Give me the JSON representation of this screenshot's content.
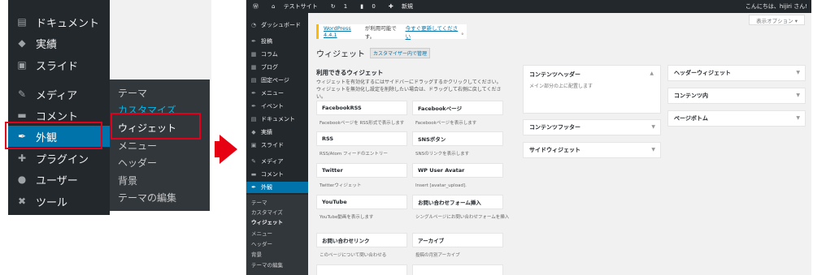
{
  "zoom_menu": {
    "items": [
      {
        "icon": "document-icon",
        "glyph": "▤",
        "label": "ドキュメント"
      },
      {
        "icon": "tag-icon",
        "glyph": "◆",
        "label": "実績"
      },
      {
        "icon": "slide-icon",
        "glyph": "▣",
        "label": "スライド"
      },
      {
        "icon": "media-icon",
        "glyph": "✎",
        "label": "メディア"
      },
      {
        "icon": "comment-icon",
        "glyph": "▬",
        "label": "コメント"
      },
      {
        "icon": "appearance-icon",
        "glyph": "✒",
        "label": "外観"
      },
      {
        "icon": "plugin-icon",
        "glyph": "✚",
        "label": "プラグイン"
      },
      {
        "icon": "user-icon",
        "glyph": "●",
        "label": "ユーザー"
      },
      {
        "icon": "tool-icon",
        "glyph": "✖",
        "label": "ツール"
      }
    ],
    "submenu": [
      "テーマ",
      "カスタマイズ",
      "ウィジェット",
      "メニュー",
      "ヘッダー",
      "背景",
      "テーマの編集"
    ]
  },
  "admin_bar": {
    "site": "テストサイト",
    "updates": "1",
    "comments": "0",
    "new": "新規",
    "greeting": "こんにちは、hijiri さん!"
  },
  "sidebar": {
    "items": [
      "ダッシュボード",
      "投稿",
      "コラム",
      "ブログ",
      "固定ページ",
      "メニュー",
      "イベント",
      "ドキュメント",
      "実績",
      "スライド",
      "メディア",
      "コメント",
      "外観"
    ],
    "submenu": [
      "テーマ",
      "カスタマイズ",
      "ウィジェット",
      "メニュー",
      "ヘッダー",
      "背景",
      "テーマの編集"
    ]
  },
  "main": {
    "screen_options": "表示オプション ▾",
    "notice_link1": "WordPress 4.4.1",
    "notice_text": " が利用可能です。",
    "notice_link2": "今すぐ更新してください",
    "notice_end": "。",
    "page_title": "ウィジェット",
    "customizer_button": "カスタマイザー内で管理",
    "available_title": "利用できるウィジェット",
    "available_desc": "ウィジェットを有効化するにはサイドバーにドラッグするかクリックしてください。ウィジェットを無効化し設定を削除したい場合は、ドラッグして右側に戻してください。",
    "widgets": [
      {
        "name": "FacebookRSS",
        "desc": "Facebookページを RSS形式で表示します"
      },
      {
        "name": "Facebookページ",
        "desc": "Facebookページを表示します"
      },
      {
        "name": "RSS",
        "desc": "RSS/Atom フィードのエントリー"
      },
      {
        "name": "SNSボタン",
        "desc": "SNSのリンクを表示します"
      },
      {
        "name": "Twitter",
        "desc": "Twitterウィジェット"
      },
      {
        "name": "WP User Avatar",
        "desc": "Insert [avatar_upload]."
      },
      {
        "name": "YouTube",
        "desc": "YouTube動画を表示します"
      },
      {
        "name": "お問い合わせフォーム挿入",
        "desc": "シングルページにお問い合わせフォームを挿入"
      },
      {
        "name": "お問い合わせリンク",
        "desc": "このページについて問い合わせる"
      },
      {
        "name": "アーカイブ",
        "desc": "投稿の月別アーカイブ"
      }
    ],
    "areas_col1": [
      {
        "name": "コンテンツヘッダー",
        "desc": "メイン部分の上に配置します"
      },
      {
        "name": "コンテンツフッター"
      },
      {
        "name": "サイドウィジェット"
      }
    ],
    "areas_col2": [
      {
        "name": "ヘッダーウィジェット"
      },
      {
        "name": "コンテンツ内"
      },
      {
        "name": "ページボトム"
      }
    ]
  }
}
